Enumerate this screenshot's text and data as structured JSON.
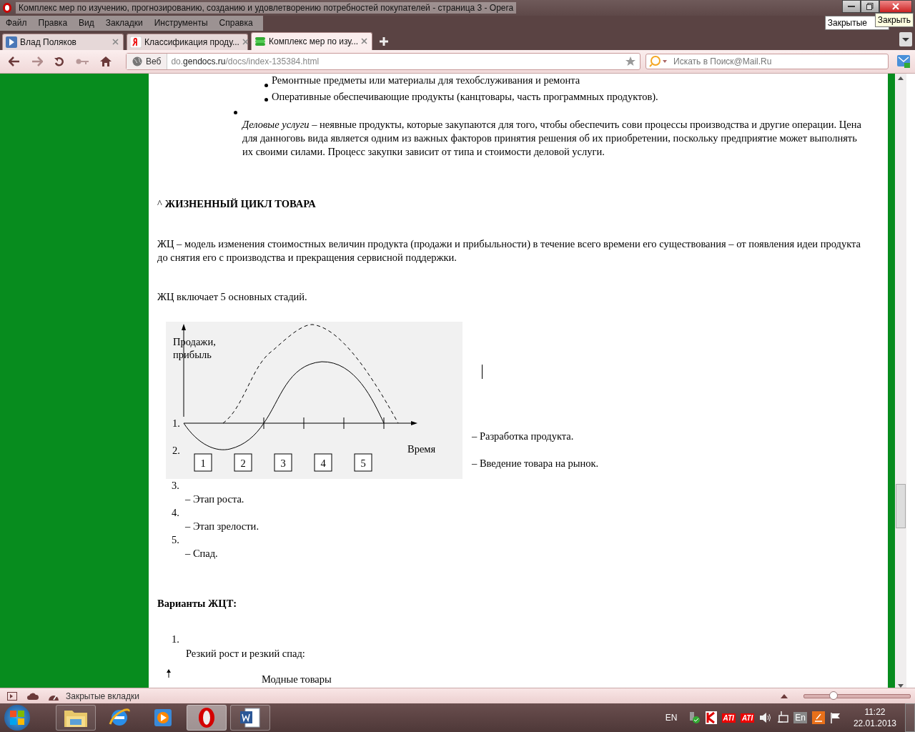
{
  "window": {
    "title": "Комплекс мер по изучению, прогнозированию, созданию и удовлетворению потребностей покупателей - страница 3 - Opera",
    "tooltip_behind": "Закрытые",
    "tooltip": "Закрыть"
  },
  "menu": [
    "Файл",
    "Правка",
    "Вид",
    "Закладки",
    "Инструменты",
    "Справка"
  ],
  "tabs": [
    {
      "label": "Влад Поляков",
      "kind": "play",
      "selected": false
    },
    {
      "label": "Классификация проду...",
      "kind": "yandex",
      "selected": false
    },
    {
      "label": "Комплекс мер по изу...",
      "kind": "doc",
      "selected": true
    }
  ],
  "address_bar": {
    "security": "Веб",
    "url": "do.**gendocs.ru**/docs/index-135384.html"
  },
  "search": {
    "placeholder": "Искать в Поиск@Mail.Ru"
  },
  "document": {
    "sub_bullets": [
      "Ремонтные предметы или материалы для техобслуживания и ремонта",
      "Оперативные обеспечивающие продукты (канцтовары, часть программных продуктов)."
    ],
    "bullet": "*Деловые услуги* – неявные продукты, которые закупаются для того, чтобы обеспечить сови процессы производства и другие операции. Цена для данноговь вида является одним из важных факторов принятия решения об их приобретении, поскольку предприятие может выполнять их своими силами. Процесс закупки зависит от типа и стоимости деловой услуги.",
    "heading_mark": "^",
    "heading": "ЖИЗНЕННЫЙ ЦИКЛ ТОВАРА",
    "paragraph": "ЖЦ – модель изменения стоимостных величин продукта (продажи и прибыльности) в течение всего времени его существования – от появления идеи продукта до снятия его с производства и прекращения сервисной поддержки.",
    "stages_intro": "ЖЦ включает 5 основных стадий.",
    "figure": {
      "ylabel_lines": [
        "Продажи,",
        "прибыль"
      ],
      "xlabel": "Время",
      "stage_boxes": [
        "1",
        "2",
        "3",
        "4",
        "5"
      ]
    },
    "stages": [
      {
        "number": "1.",
        "text": "– Разработка продукта."
      },
      {
        "number": "2.",
        "text": "– Введение товара на рынок."
      },
      {
        "number": "3.",
        "text": "– Этап роста."
      },
      {
        "number": "4.",
        "text": "– Этап зрелости."
      },
      {
        "number": "5.",
        "text": "– Спад."
      }
    ],
    "variants_heading": "Варианты ЖЦТ:",
    "variant": {
      "number": "1.",
      "text": "Резкий рост и резкий спад:"
    },
    "next_figure_label": "Модные товары"
  },
  "status_bar": {
    "label": "Закрытые вкладки",
    "zoom": {
      "level": 0.28
    }
  },
  "taskbar": {
    "apps": [
      {
        "kind": "folder",
        "running": true,
        "selected": false
      },
      {
        "kind": "ie",
        "running": false,
        "selected": false
      },
      {
        "kind": "media",
        "running": false,
        "selected": false
      },
      {
        "kind": "opera",
        "running": true,
        "selected": true
      },
      {
        "kind": "word",
        "running": true,
        "selected": false
      }
    ],
    "language": "EN",
    "ati_labels": [
      "ATI",
      "ATI"
    ],
    "keyboard": "En",
    "time": "11:22",
    "date": "22.01.2013"
  }
}
